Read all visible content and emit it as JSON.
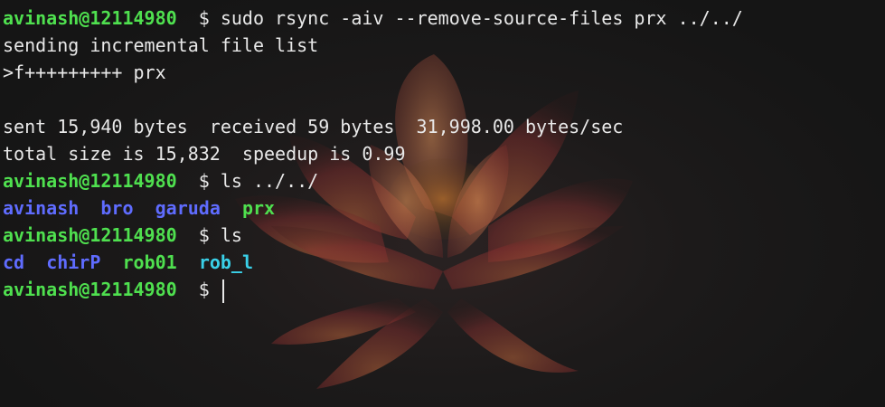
{
  "terminal": {
    "lines": [
      {
        "type": "prompt",
        "user": "avinash@12114980",
        "symbol": "$",
        "command": "sudo rsync -aiv --remove-source-files prx ../../"
      },
      {
        "type": "text",
        "text": "sending incremental file list"
      },
      {
        "type": "text",
        "text": ">f+++++++++ prx"
      },
      {
        "type": "text",
        "text": ""
      },
      {
        "type": "text",
        "text": "sent 15,940 bytes  received 59 bytes  31,998.00 bytes/sec"
      },
      {
        "type": "text",
        "text": "total size is 15,832  speedup is 0.99"
      },
      {
        "type": "prompt",
        "user": "avinash@12114980",
        "symbol": "$",
        "command": "ls ../../"
      },
      {
        "type": "dirs",
        "entries": [
          "avinash",
          "bro",
          "garuda",
          "prx"
        ]
      },
      {
        "type": "prompt",
        "user": "avinash@12114980",
        "symbol": "$",
        "command": "ls"
      },
      {
        "type": "dirs",
        "entries": [
          "cd",
          "chirP",
          "rob01",
          "rob_l"
        ]
      },
      {
        "type": "prompt",
        "user": "avinash@12114980",
        "symbol": "$",
        "command": ""
      }
    ]
  },
  "colors": {
    "prompt_user": "#4fe04f",
    "directory": "#5f6cff",
    "directory_highlight": "#3ad0e8",
    "text": "#e8e8e8",
    "background": "#181818"
  },
  "icons": {
    "background": "lotus-flower-wallpaper"
  }
}
